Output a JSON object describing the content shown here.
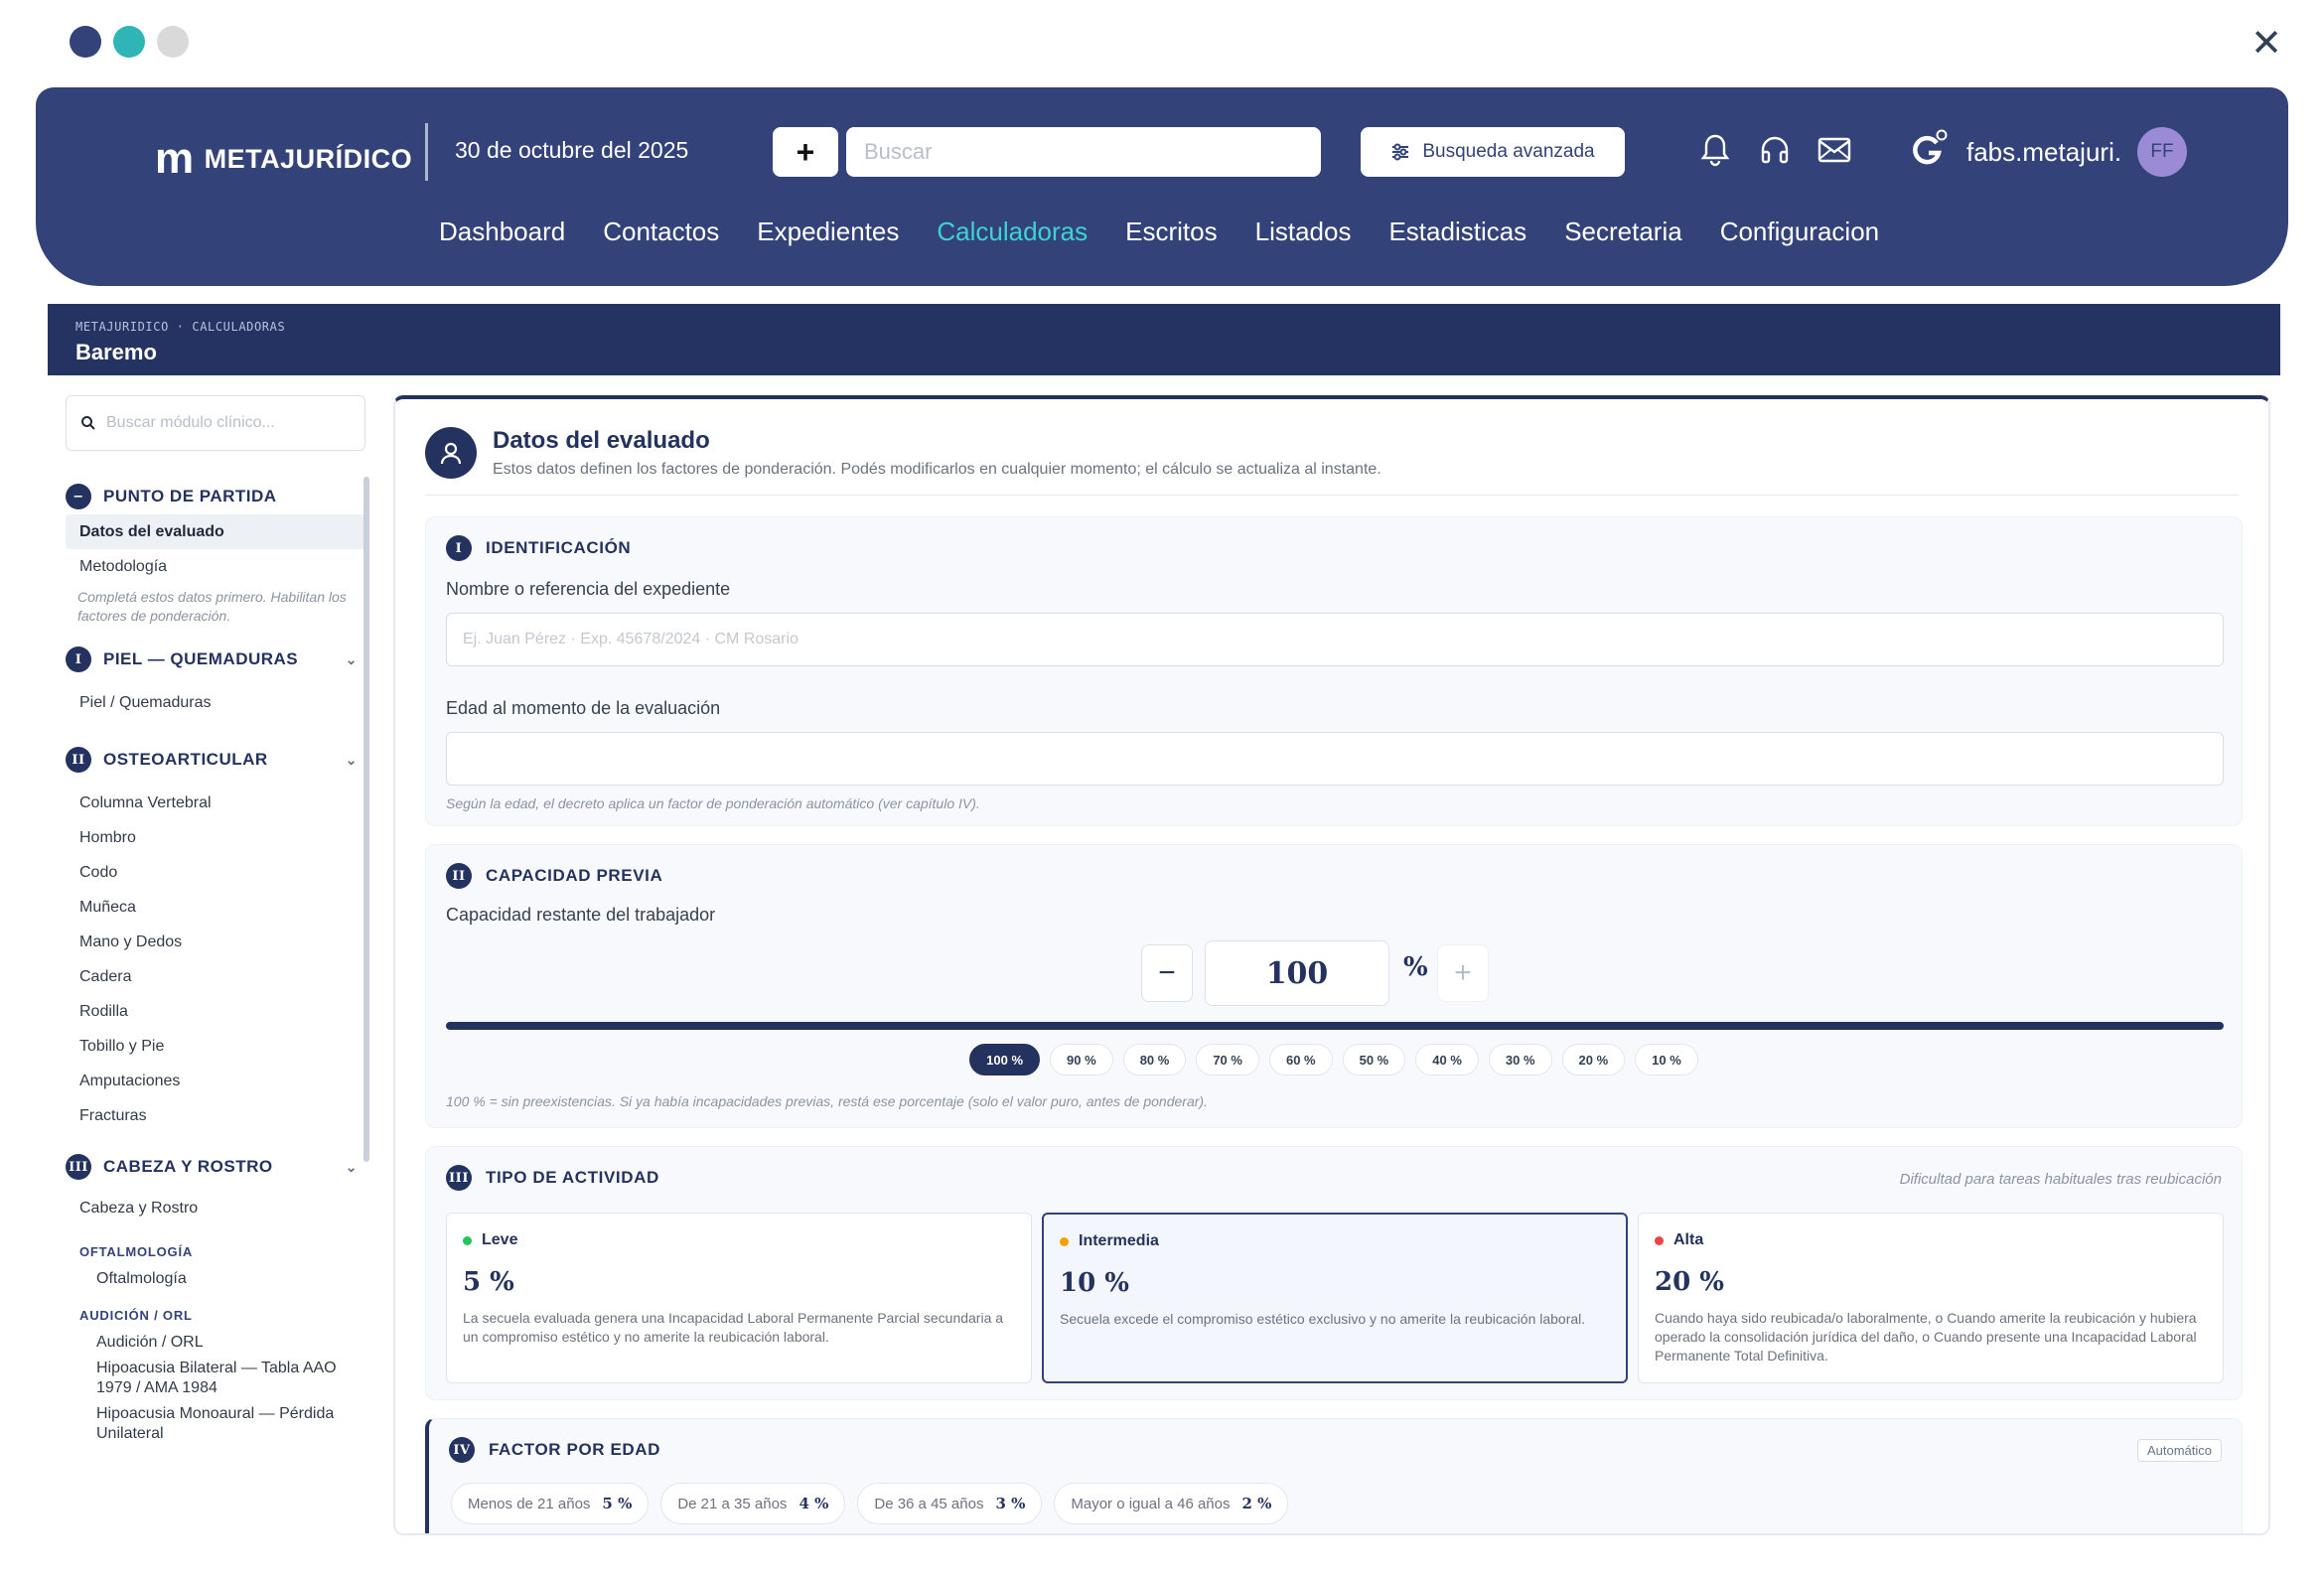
{
  "window": {
    "dot_colors": [
      "#33437a",
      "#2fb5b5",
      "#d9d9d9"
    ]
  },
  "topbar": {
    "logo_text": "METAJURÍDICO",
    "date": "30 de octubre del 2025",
    "search_placeholder": "Buscar",
    "advanced_search_label": "Busqueda avanzada",
    "user_name": "fabs.metajuri.",
    "avatar_initials": "FF",
    "nav": [
      "Dashboard",
      "Contactos",
      "Expedientes",
      "Calculadoras",
      "Escritos",
      "Listados",
      "Estadisticas",
      "Secretaria",
      "Configuracion"
    ],
    "active_nav": "Calculadoras",
    "accent_color": "#3dd3d1",
    "icons": [
      "bell-icon",
      "headset-icon",
      "mail-icon",
      "g-icon"
    ]
  },
  "breadcrumb": {
    "path": "METAJURIDICO · CALCULADORAS",
    "title": "Baremo"
  },
  "sidebar": {
    "search_placeholder": "Buscar módulo clínico...",
    "sections": [
      {
        "label": "PUNTO DE PARTIDA",
        "items": [
          "Datos del evaluado",
          "Metodología"
        ],
        "note": "Completá estos datos primero. Habilitan los factores de ponderación."
      },
      {
        "label": "PIEL — QUEMADURAS",
        "items": [
          "Piel / Quemaduras"
        ]
      },
      {
        "label": "OSTEOARTICULAR",
        "items": [
          "Columna Vertebral",
          "Hombro",
          "Codo",
          "Muñeca",
          "Mano y Dedos",
          "Cadera",
          "Rodilla",
          "Tobillo y Pie",
          "Amputaciones",
          "Fracturas"
        ]
      },
      {
        "label": "CABEZA Y ROSTRO",
        "items": [
          "Cabeza y Rostro"
        ],
        "groups": [
          {
            "label": "OFTALMOLOGÍA",
            "items": [
              "Oftalmología"
            ]
          },
          {
            "label": "AUDICIÓN / ORL",
            "items": [
              "Audición / ORL",
              "Hipoacusia Bilateral — Tabla AAO 1979 / AMA 1984",
              "Hipoacusia Monoaural — Pérdida Unilateral"
            ]
          }
        ]
      }
    ]
  },
  "main": {
    "title": "Datos del evaluado",
    "subtitle": "Estos datos definen los factores de ponderación. Podés modificarlos en cualquier momento; el cálculo se actualiza al instante.",
    "identificacion": {
      "heading": "IDENTIFICACIÓN",
      "name_label": "Nombre o referencia del expediente",
      "name_placeholder": "Ej. Juan Pérez · Exp. 45678/2024 · CM Rosario",
      "age_label": "Edad al momento de la evaluación",
      "age_value": "",
      "age_hint": "Según la edad, el decreto aplica un factor de ponderación automático (ver capítulo IV)."
    },
    "capacidad": {
      "heading": "CAPACIDAD PREVIA",
      "label": "Capacidad restante del trabajador",
      "value": "100",
      "unit": "%",
      "minus": "−",
      "plus": "+",
      "slider_percent": 100,
      "chips": [
        "100 %",
        "90 %",
        "80 %",
        "70 %",
        "60 %",
        "50 %",
        "40 %",
        "30 %",
        "20 %",
        "10 %"
      ],
      "selected_chip": "100 %",
      "hint": "100 % = sin preexistencias. Si ya había incapacidades previas, restá ese porcentaje (solo el valor puro, antes de ponderar)."
    },
    "actividad": {
      "heading": "TIPO DE ACTIVIDAD",
      "note": "Dificultad para tareas habituales tras reubicación",
      "options": [
        {
          "label": "Leve",
          "pct": "5 %",
          "color": "#22c55e",
          "desc": "La secuela evaluada genera una Incapacidad Laboral Permanente Parcial secundaria a un compromiso estético y no amerite la reubicación laboral."
        },
        {
          "label": "Intermedia",
          "pct": "10 %",
          "color": "#f59e0b",
          "desc": "Secuela excede el compromiso estético exclusivo y no amerite la reubicación laboral."
        },
        {
          "label": "Alta",
          "pct": "20 %",
          "color": "#ef4444",
          "desc": "Cuando haya sido reubicada/o laboralmente, o Cuando amerite la reubicación y hubiera operado la consolidación jurídica del daño, o Cuando presente una Incapacidad Laboral Permanente Total Definitiva."
        }
      ],
      "selected": "Intermedia"
    },
    "edad": {
      "heading": "FACTOR POR EDAD",
      "badge": "Automático",
      "chips": [
        {
          "label": "Menos de 21 años",
          "value": "5 %"
        },
        {
          "label": "De 21 a 35 años",
          "value": "4 %"
        },
        {
          "label": "De 36 a 45 años",
          "value": "3 %"
        },
        {
          "label": "Mayor o igual a 46 años",
          "value": "2 %"
        }
      ]
    }
  }
}
